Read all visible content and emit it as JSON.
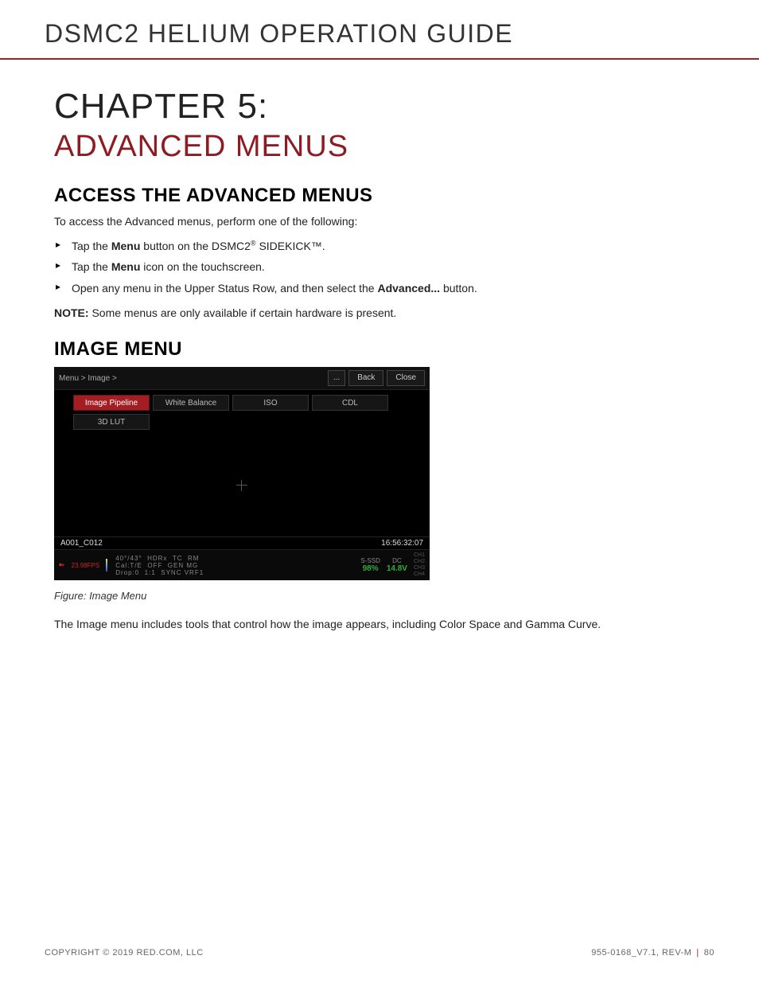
{
  "header": {
    "doc_title": "DSMC2 HELIUM OPERATION GUIDE"
  },
  "chapter": {
    "number_label": "CHAPTER 5:",
    "name": "ADVANCED MENUS"
  },
  "section1": {
    "heading": "ACCESS THE ADVANCED MENUS",
    "intro": "To access the Advanced menus, perform one of the following:",
    "bullets": {
      "b0_pre": "Tap the ",
      "b0_menu": "Menu",
      "b0_mid": " button on the DSMC2",
      "b0_sup": "®",
      "b0_post": " SIDEKICK™.",
      "b1_pre": "Tap the ",
      "b1_menu": "Menu",
      "b1_post": " icon on the touchscreen.",
      "b2_pre": "Open any menu in the Upper Status Row, and then select the ",
      "b2_adv": "Advanced...",
      "b2_post": " button."
    },
    "note_label": "NOTE:",
    "note_text": " Some menus are only available if certain hardware is present."
  },
  "section2": {
    "heading": "IMAGE MENU",
    "caption": "Figure: Image Menu",
    "description": "The Image menu includes tools that control how the image appears, including Color Space and Gamma Curve."
  },
  "camera_ui": {
    "breadcrumb": "Menu > Image >",
    "nav": {
      "more": "...",
      "back": "Back",
      "close": "Close"
    },
    "tabs": {
      "pipeline": "Image Pipeline",
      "wb": "White Balance",
      "iso": "ISO",
      "cdl": "CDL",
      "lut": "3D LUT"
    },
    "clip": "A001_C012",
    "timecode": "16:56:32:07",
    "status": {
      "fps": "23.98FPS",
      "temps": "40°/43°",
      "hdrx": "HDRx",
      "tc": "TC",
      "rm": "RM",
      "cal": "Cal:T/E",
      "off": "OFF",
      "gen": "GEN",
      "mg": "MG",
      "drop": "Drop:0",
      "r11": "1:1",
      "sync": "SYNC",
      "vrf1": "VRF1",
      "ssd_label": "S-SSD",
      "ssd_pct": "98%",
      "dc_label": "DC",
      "dc_v": "14.8V",
      "ch_col": "CH1\nCH2\nCH3\nCH4"
    }
  },
  "footer": {
    "copyright": "COPYRIGHT © 2019 RED.COM, LLC",
    "docnum": "955-0168_V7.1, REV-M",
    "page": "80"
  }
}
